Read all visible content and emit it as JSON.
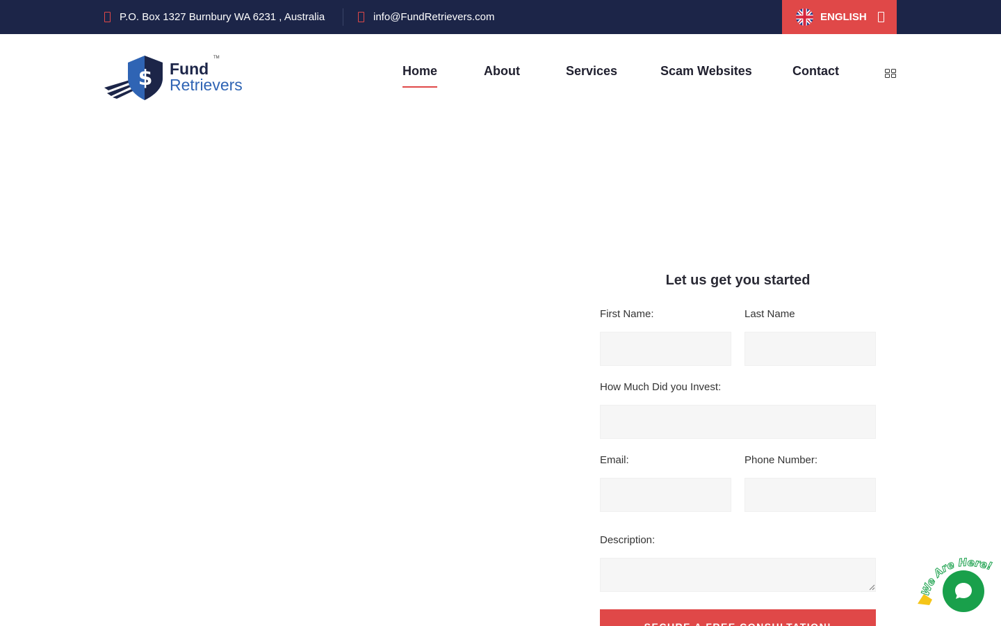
{
  "topbar": {
    "address": "P.O. Box 1327 Burnbury WA 6231 , Australia",
    "email": "info@FundRetrievers.com",
    "language": "ENGLISH",
    "accent_color": "#e04848",
    "background_color": "#1c2548"
  },
  "header": {
    "logo_line1": "Fund",
    "logo_line2": "Retrievers",
    "logo_mark": "TM",
    "nav": [
      {
        "label": "Home",
        "active": true
      },
      {
        "label": "About",
        "active": false
      },
      {
        "label": "Services",
        "active": false
      },
      {
        "label": "Scam Websites",
        "active": false
      },
      {
        "label": "Contact",
        "active": false
      }
    ],
    "menu_icon": "grid-icon"
  },
  "form": {
    "title": "Let us get you started",
    "first_name_label": "First Name:",
    "last_name_label": "Last Name",
    "invest_label": "How Much Did you Invest:",
    "email_label": "Email:",
    "phone_label": "Phone Number:",
    "description_label": "Description:",
    "submit_label": "SECURE A FREE CONSULTATION!"
  },
  "chat": {
    "badge_text": "We Are Here!",
    "icon": "chat-bubble-icon",
    "color": "#19a04b"
  }
}
